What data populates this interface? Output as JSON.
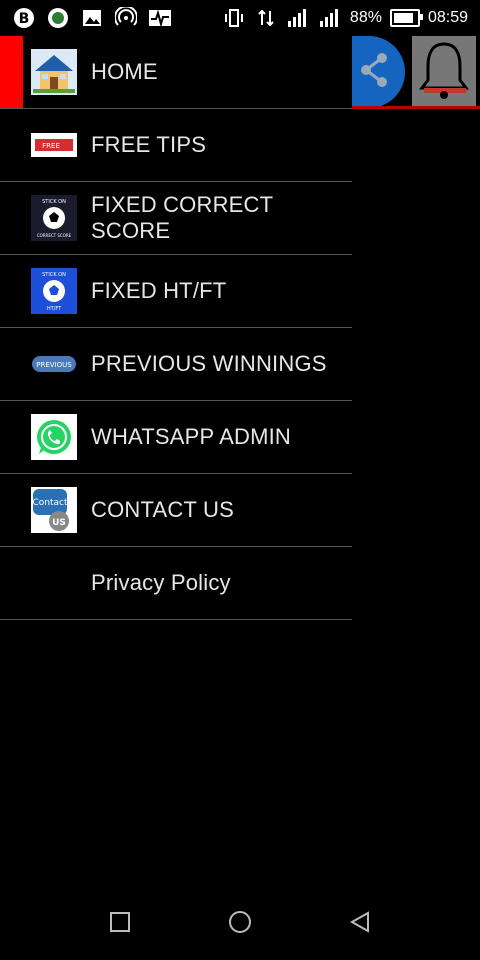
{
  "status_bar": {
    "battery_percent": "88%",
    "time": "08:59",
    "battery_level": 0.88,
    "left_icons": [
      "b-app-icon",
      "circle-app-icon",
      "image-icon",
      "hotspot-icon",
      "activity-icon"
    ],
    "right_icons": [
      "vibrate-icon",
      "data-arrows-icon",
      "signal-h-icon",
      "signal-h-icon"
    ]
  },
  "app_bar": {
    "actions": [
      "share-icon",
      "bell-icon"
    ],
    "colors": {
      "share_bg": "#1565c0",
      "bell_bg": "#777777",
      "accent": "#ff0000"
    }
  },
  "drawer": {
    "items": [
      {
        "label": "HOME",
        "icon": "house-icon",
        "active": true
      },
      {
        "label": "FREE TIPS",
        "icon": "free-badge-icon"
      },
      {
        "label": "FIXED CORRECT SCORE",
        "icon": "soccer-ball-icon"
      },
      {
        "label": "FIXED HT/FT",
        "icon": "soccer-ball-blue-icon"
      },
      {
        "label": "PREVIOUS WINNINGS",
        "icon": "previous-badge-icon"
      },
      {
        "label": "WHATSAPP ADMIN",
        "icon": "whatsapp-icon"
      },
      {
        "label": "CONTACT US",
        "icon": "contact-us-icon"
      },
      {
        "label": "Privacy Policy",
        "icon": ""
      }
    ]
  },
  "icon_text": {
    "free": "FREE",
    "stick_top": "STICK ON",
    "score_caption": "CORRECT SCORE",
    "htft_caption": "HT/FT",
    "previous": "PREVIOUS",
    "contact": "Contact",
    "us": "US"
  },
  "nav_bar": {
    "buttons": [
      "recent-apps-icon",
      "home-circle-icon",
      "back-triangle-icon"
    ]
  }
}
